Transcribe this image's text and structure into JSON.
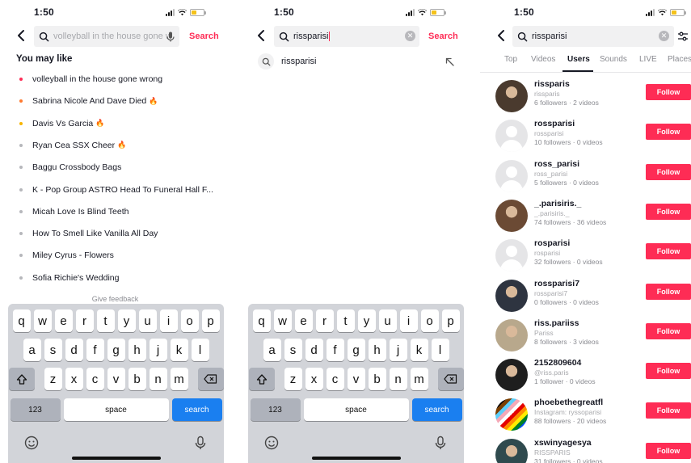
{
  "status_bar": {
    "time": "1:50"
  },
  "screen1": {
    "search_placeholder": "volleyball in the house gone w",
    "search_label": "Search",
    "you_may_like": "You may like",
    "suggestions": [
      {
        "text": "volleyball in the house gone wrong",
        "dot_color": "#fe2c55",
        "trending": false
      },
      {
        "text": "Sabrina Nicole And Dave Died",
        "dot_color": "#ff7a2f",
        "trending": true
      },
      {
        "text": "Davis Vs Garcia",
        "dot_color": "#f7b500",
        "trending": true
      },
      {
        "text": "Ryan Cea SSX Cheer",
        "dot_color": "#b6b7bb",
        "trending": true
      },
      {
        "text": "Baggu Crossbody Bags",
        "dot_color": "#b6b7bb",
        "trending": false
      },
      {
        "text": "K - Pop Group ASTRO Head To Funeral Hall F...",
        "dot_color": "#b6b7bb",
        "trending": false
      },
      {
        "text": "Micah Love Is Blind Teeth",
        "dot_color": "#b6b7bb",
        "trending": false
      },
      {
        "text": "How To Smell Like Vanilla All Day",
        "dot_color": "#b6b7bb",
        "trending": false
      },
      {
        "text": "Miley Cyrus - Flowers",
        "dot_color": "#b6b7bb",
        "trending": false
      },
      {
        "text": "Sofia Richie's Wedding",
        "dot_color": "#b6b7bb",
        "trending": false
      }
    ],
    "give_feedback": "Give feedback"
  },
  "screen2": {
    "query": "rissparisi",
    "search_label": "Search",
    "suggestion": "rissparisi"
  },
  "screen3": {
    "query": "rissparisi",
    "tabs": [
      "Top",
      "Videos",
      "Users",
      "Sounds",
      "LIVE",
      "Places"
    ],
    "active_tab": "Users",
    "follow_label": "Follow",
    "users": [
      {
        "name": "rissparis",
        "handle": "rissparis",
        "stats": "6 followers · 2 videos",
        "avatar": "photo"
      },
      {
        "name": "rossparisi",
        "handle": "rossparisi",
        "stats": "10 followers · 0 videos",
        "avatar": "default"
      },
      {
        "name": "ross_parisi",
        "handle": "ross_parisi",
        "stats": "5 followers · 0 videos",
        "avatar": "default"
      },
      {
        "name": "_.parisiris._",
        "handle": "_.parisiris._",
        "stats": "74 followers · 36 videos",
        "avatar": "photo"
      },
      {
        "name": "rosparisi",
        "handle": "rosparisi",
        "stats": "32 followers · 0 videos",
        "avatar": "default"
      },
      {
        "name": "rossparisi7",
        "handle": "rossparisi7",
        "stats": "0 followers · 0 videos",
        "avatar": "photo"
      },
      {
        "name": "riss.pariiss",
        "handle": "Pariss",
        "stats": "8 followers · 3 videos",
        "avatar": "photo"
      },
      {
        "name": "2152809604",
        "handle": "@riss.paris",
        "stats": "1 follower · 0 videos",
        "avatar": "photo"
      },
      {
        "name": "phoebethegreatfl",
        "handle": "Instagram: ryssoparisi",
        "stats": "88 followers · 20 videos",
        "avatar": "flag"
      },
      {
        "name": "xswinyagesya",
        "handle": "RISSPARIS",
        "stats": "31 followers · 0 videos",
        "avatar": "photo"
      }
    ]
  },
  "keyboard": {
    "row1": [
      "q",
      "w",
      "e",
      "r",
      "t",
      "y",
      "u",
      "i",
      "o",
      "p"
    ],
    "row2": [
      "a",
      "s",
      "d",
      "f",
      "g",
      "h",
      "j",
      "k",
      "l"
    ],
    "row3": [
      "z",
      "x",
      "c",
      "v",
      "b",
      "n",
      "m"
    ],
    "numbers_label": "123",
    "space_label": "space",
    "search_label": "search"
  }
}
